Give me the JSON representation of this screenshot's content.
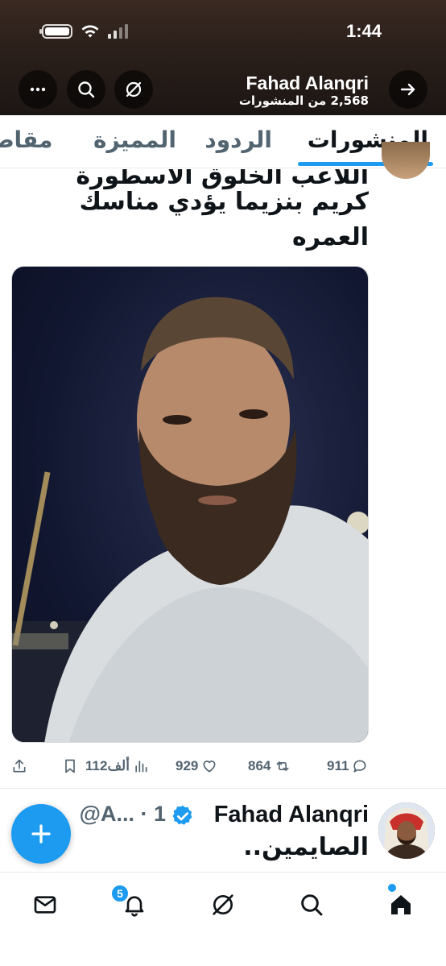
{
  "status_bar": {
    "time": "1:44"
  },
  "header": {
    "name": "Fahad Alanqri",
    "posts_count": "2,568 من المنشورات",
    "icons": [
      "more-icon",
      "search-icon",
      "grok-icon",
      "forward-arrow-icon"
    ]
  },
  "tabs": [
    {
      "label": "المنشورات",
      "active": true
    },
    {
      "label": "الردود",
      "active": false
    },
    {
      "label": "المميزة",
      "active": false
    },
    {
      "label": "مقاطع",
      "active": false
    }
  ],
  "tweet1": {
    "lines": [
      "اللاعب الخلوق الأسطورة",
      "كريم بنزيما يؤدي مناسك",
      "العمره"
    ],
    "stats": {
      "replies": "911",
      "retweets": "864",
      "likes": "929",
      "views": "112ألف"
    }
  },
  "tweet2": {
    "name": "Fahad Alanqri",
    "handle": "@A... · 1",
    "text": "الصايمين.."
  },
  "bottom_nav": {
    "items": [
      "home-icon",
      "search-icon",
      "grok-icon",
      "notifications-icon",
      "messages-icon"
    ],
    "notifications_badge": "5"
  },
  "colors": {
    "accent": "#1d9bf0",
    "text": "#0f1419",
    "muted": "#536471"
  }
}
